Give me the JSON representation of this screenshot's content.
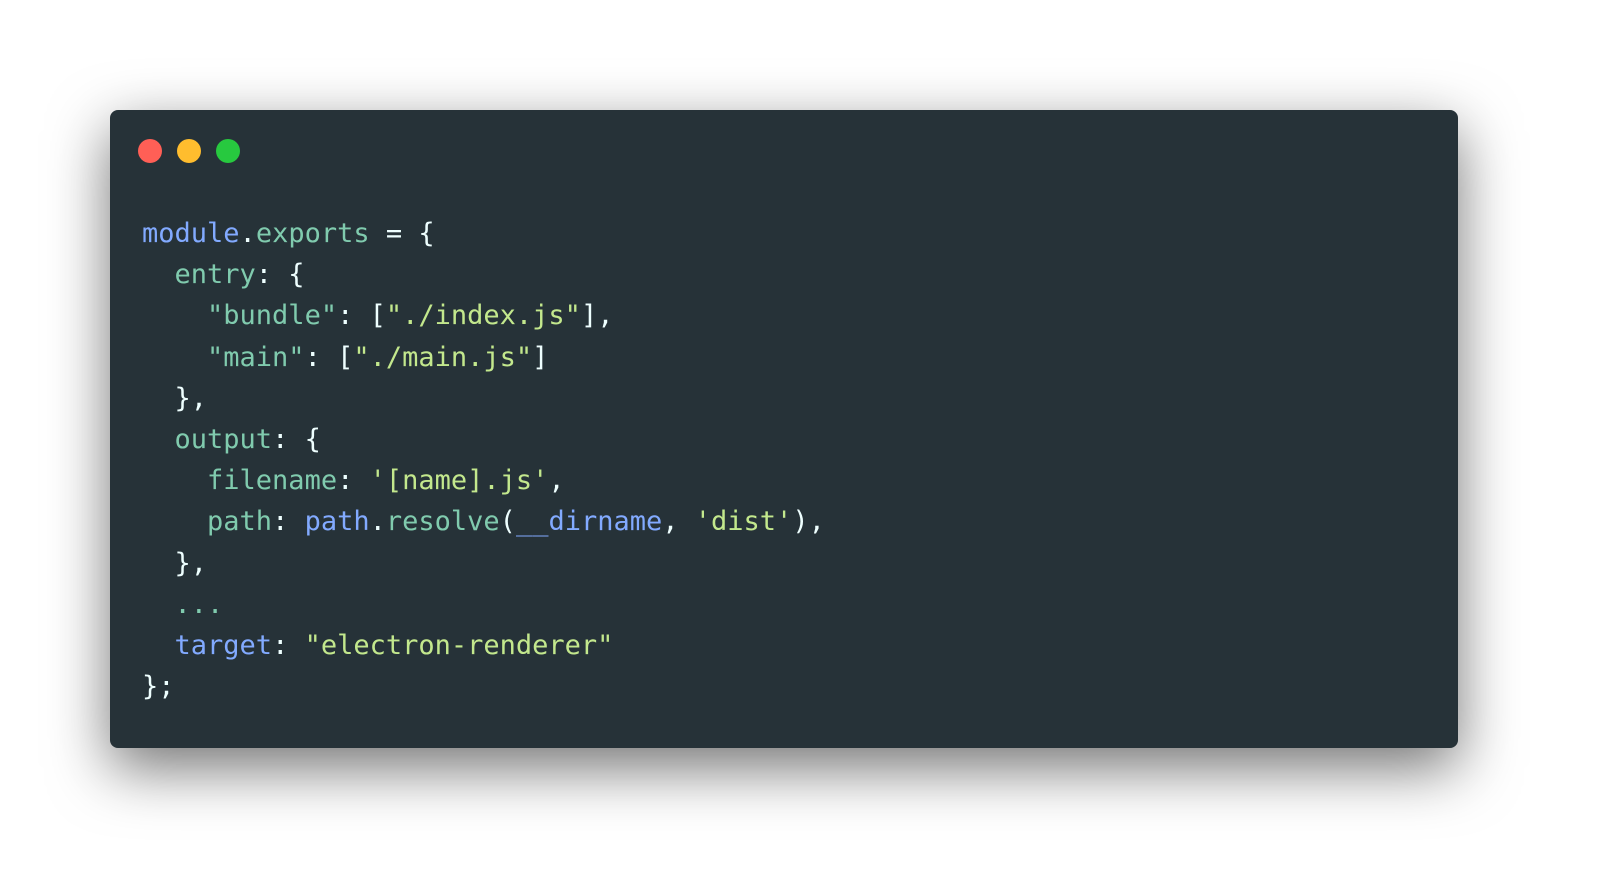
{
  "colors": {
    "background": "#263238",
    "close": "#ff5f56",
    "minimize": "#ffbd2e",
    "maximize": "#27c93f",
    "plain": "#eeffff",
    "ident": "#82aaff",
    "prop": "#80cbae",
    "string": "#c3e88d"
  },
  "window_controls": [
    "close",
    "minimize",
    "maximize"
  ],
  "code_lines": [
    [
      [
        "ident",
        "module"
      ],
      [
        "plain",
        "."
      ],
      [
        "prop",
        "exports"
      ],
      [
        "plain",
        " = {"
      ]
    ],
    [
      [
        "plain",
        "  "
      ],
      [
        "prop",
        "entry"
      ],
      [
        "plain",
        ": {"
      ]
    ],
    [
      [
        "plain",
        "    "
      ],
      [
        "prop",
        "\"bundle\""
      ],
      [
        "plain",
        ": ["
      ],
      [
        "string",
        "\"./index.js\""
      ],
      [
        "plain",
        "],"
      ]
    ],
    [
      [
        "plain",
        "    "
      ],
      [
        "prop",
        "\"main\""
      ],
      [
        "plain",
        ": ["
      ],
      [
        "string",
        "\"./main.js\""
      ],
      [
        "plain",
        "]"
      ]
    ],
    [
      [
        "plain",
        "  },"
      ]
    ],
    [
      [
        "plain",
        "  "
      ],
      [
        "prop",
        "output"
      ],
      [
        "plain",
        ": {"
      ]
    ],
    [
      [
        "plain",
        "    "
      ],
      [
        "prop",
        "filename"
      ],
      [
        "plain",
        ": "
      ],
      [
        "string",
        "'[name].js'"
      ],
      [
        "plain",
        ","
      ]
    ],
    [
      [
        "plain",
        "    "
      ],
      [
        "prop",
        "path"
      ],
      [
        "plain",
        ": "
      ],
      [
        "ident",
        "path"
      ],
      [
        "plain",
        "."
      ],
      [
        "prop",
        "resolve"
      ],
      [
        "plain",
        "("
      ],
      [
        "ident",
        "__dirname"
      ],
      [
        "plain",
        ", "
      ],
      [
        "string",
        "'dist'"
      ],
      [
        "plain",
        "),"
      ]
    ],
    [
      [
        "plain",
        "  },"
      ]
    ],
    [
      [
        "plain",
        "  "
      ],
      [
        "prop",
        "..."
      ]
    ],
    [
      [
        "plain",
        "  "
      ],
      [
        "ident",
        "target"
      ],
      [
        "plain",
        ": "
      ],
      [
        "string",
        "\"electron-renderer\""
      ]
    ],
    [
      [
        "plain",
        "};"
      ]
    ]
  ]
}
